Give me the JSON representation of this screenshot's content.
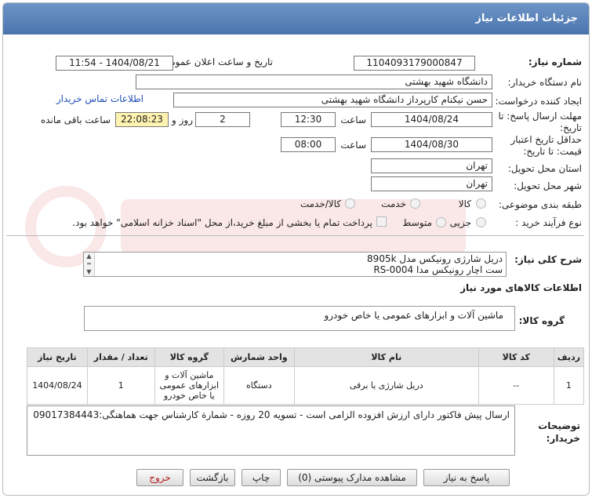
{
  "header": {
    "title": "جزئیات اطلاعات نیاز"
  },
  "form": {
    "need_number_label": "شماره نیاز:",
    "need_number": "1104093179000847",
    "announce_label": "تاریخ و ساعت اعلان عمومی:",
    "announce_value": "1404/08/21 - 11:54",
    "buyer_label": "نام دستگاه خریدار:",
    "buyer_value": "دانشگاه شهید بهشتی",
    "creator_label": "ایجاد کننده درخواست:",
    "creator_value": "حسن نیکنام کارپرداز دانشگاه شهید بهشتی",
    "contact_link": "اطلاعات تماس خریدار",
    "deadline_label_1": "مهلت ارسال پاسخ: تا",
    "deadline_label_2": "تاریخ:",
    "deadline_date": "1404/08/24",
    "time_label": "ساعت",
    "deadline_time": "12:30",
    "days_value": "2",
    "days_label": "روز و",
    "remaining_time": "22:08:23",
    "remaining_label": "ساعت باقی مانده",
    "validity_label_1": "حداقل تاریخ اعتبار",
    "validity_label_2": "قیمت: تا تاریخ:",
    "validity_date": "1404/08/30",
    "validity_time_label": "ساعت",
    "validity_time": "08:00",
    "province_label": "استان محل تحویل:",
    "province_value": "تهران",
    "city_label": "شهر محل تحویل:",
    "city_value": "تهران",
    "category_label": "طبقه بندی موضوعی:",
    "category_options": [
      "کالا",
      "خدمت",
      "کالا/خدمت"
    ],
    "purchase_type_label": "نوع فرآیند خرید :",
    "purchase_options": [
      "جزیی",
      "متوسط"
    ],
    "payment_note": "پرداخت تمام یا بخشی از مبلغ خرید،از محل \"اسناد خزانه اسلامی\" خواهد بود."
  },
  "need_desc": {
    "label": "شرح کلی نیاز:",
    "line1": "دریل شارژی رونیکس مدل 8905k",
    "line2": "ست اچار رونیکس مدا RS-0004"
  },
  "goods": {
    "section_title": "اطلاعات کالاهای مورد نیاز",
    "group_label": "گروه کالا:",
    "group_value": "ماشین آلات و ابزارهای عمومی یا خاص خودرو"
  },
  "table": {
    "headers": [
      "ردیف",
      "کد کالا",
      "نام کالا",
      "واحد شمارش",
      "گروه کالا",
      "تعداد / مقدار",
      "تاریخ نیاز"
    ],
    "row": {
      "index": "1",
      "code": "--",
      "name": "دریل شارژی یا برقی",
      "unit": "دستگاه",
      "group_l1": "ماشین آلات و",
      "group_l2": "ابزارهای عمومی",
      "group_l3": "یا خاص خودرو",
      "qty": "1",
      "date": "1404/08/24"
    }
  },
  "notes": {
    "label_1": "توضیحات",
    "label_2": "خریدار:",
    "text": "ارسال پیش فاکتور دارای ارزش افزوده الزامی است - تسویه 20 روزه - شمارة کارشناس جهت هماهنگی:09017384443"
  },
  "buttons": {
    "reply": "پاسخ به نیاز",
    "attachments": "مشاهده مدارک پیوستی (0)",
    "print": "چاپ",
    "back": "بازگشت",
    "exit": "خروج"
  },
  "colors": {
    "header": "#5a82b9",
    "link": "#1f4fb5",
    "yellow": "#fff3b0",
    "exit_text": "#b31b1b"
  }
}
